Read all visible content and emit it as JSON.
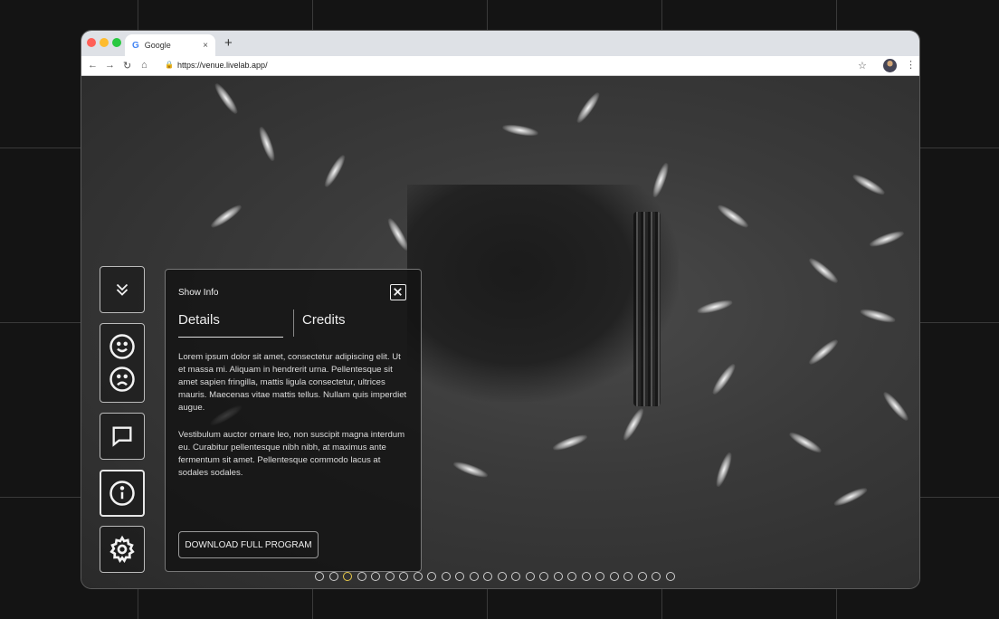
{
  "browser": {
    "tab_title": "Google",
    "tab_favicon": "G",
    "tab_close": "×",
    "new_tab": "+",
    "url": "https://venue.livelab.app/",
    "traffic_colors": [
      "#ff5f57",
      "#febc2e",
      "#28c840"
    ]
  },
  "nav_icons": {
    "back": "←",
    "forward": "→",
    "reload": "↻",
    "home": "⌂",
    "star": "☆",
    "menu": "⋮",
    "lock": "🔒"
  },
  "side_toolbar": {
    "items": [
      {
        "name": "collapse",
        "icon": "chevrons-down-icon"
      },
      {
        "name": "reactions",
        "icon": "smile-frown-icon"
      },
      {
        "name": "chat",
        "icon": "chat-icon"
      },
      {
        "name": "info",
        "icon": "info-icon",
        "active": true
      },
      {
        "name": "settings",
        "icon": "gear-icon"
      }
    ]
  },
  "panel": {
    "title": "Show Info",
    "tabs": [
      {
        "label": "Details",
        "active": true
      },
      {
        "label": "Credits",
        "active": false
      }
    ],
    "paragraphs": [
      "Lorem ipsum dolor sit amet, consectetur adipiscing elit. Ut et massa mi. Aliquam in hendrerit urna. Pellentesque sit amet sapien fringilla, mattis ligula consectetur, ultrices mauris. Maecenas vitae mattis tellus. Nullam quis imperdiet augue.",
      "Vestibulum auctor ornare leo, non suscipit magna interdum eu. Curabitur pellentesque nibh nibh, at maximus ante fermentum sit amet. Pellentesque commodo lacus at sodales sodales."
    ],
    "download_label": "DOWNLOAD FULL PROGRAM"
  },
  "pagination": {
    "total": 26,
    "active_index": 2,
    "active_color": "#e6c84a"
  }
}
